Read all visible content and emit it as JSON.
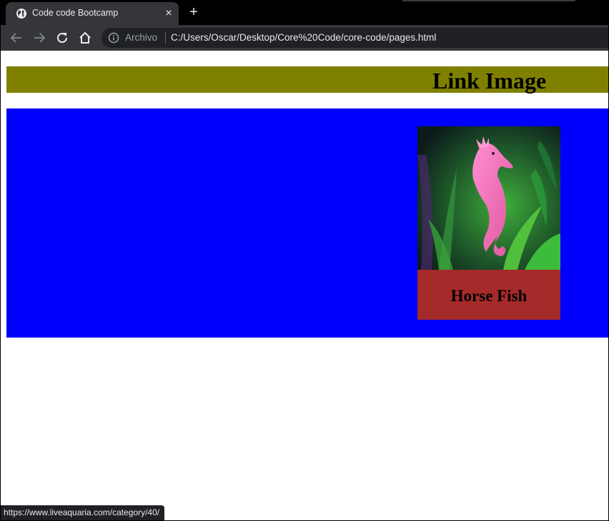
{
  "browser": {
    "tab_title": "Code code Bootcamp",
    "close_glyph": "×",
    "new_tab_glyph": "+",
    "scheme_label": "Archivo",
    "url": "C:/Users/Oscar/Desktop/Core%20Code/core-code/pages.html",
    "status_url": "https://www.liveaquaria.com/category/40/"
  },
  "page": {
    "header_title": "Link Image",
    "card": {
      "caption": "Horse Fish",
      "image_subject": "seahorse"
    }
  },
  "colors": {
    "header_bg": "#808000",
    "section_bg": "#0000ff",
    "caption_bg": "#a52a2a"
  }
}
